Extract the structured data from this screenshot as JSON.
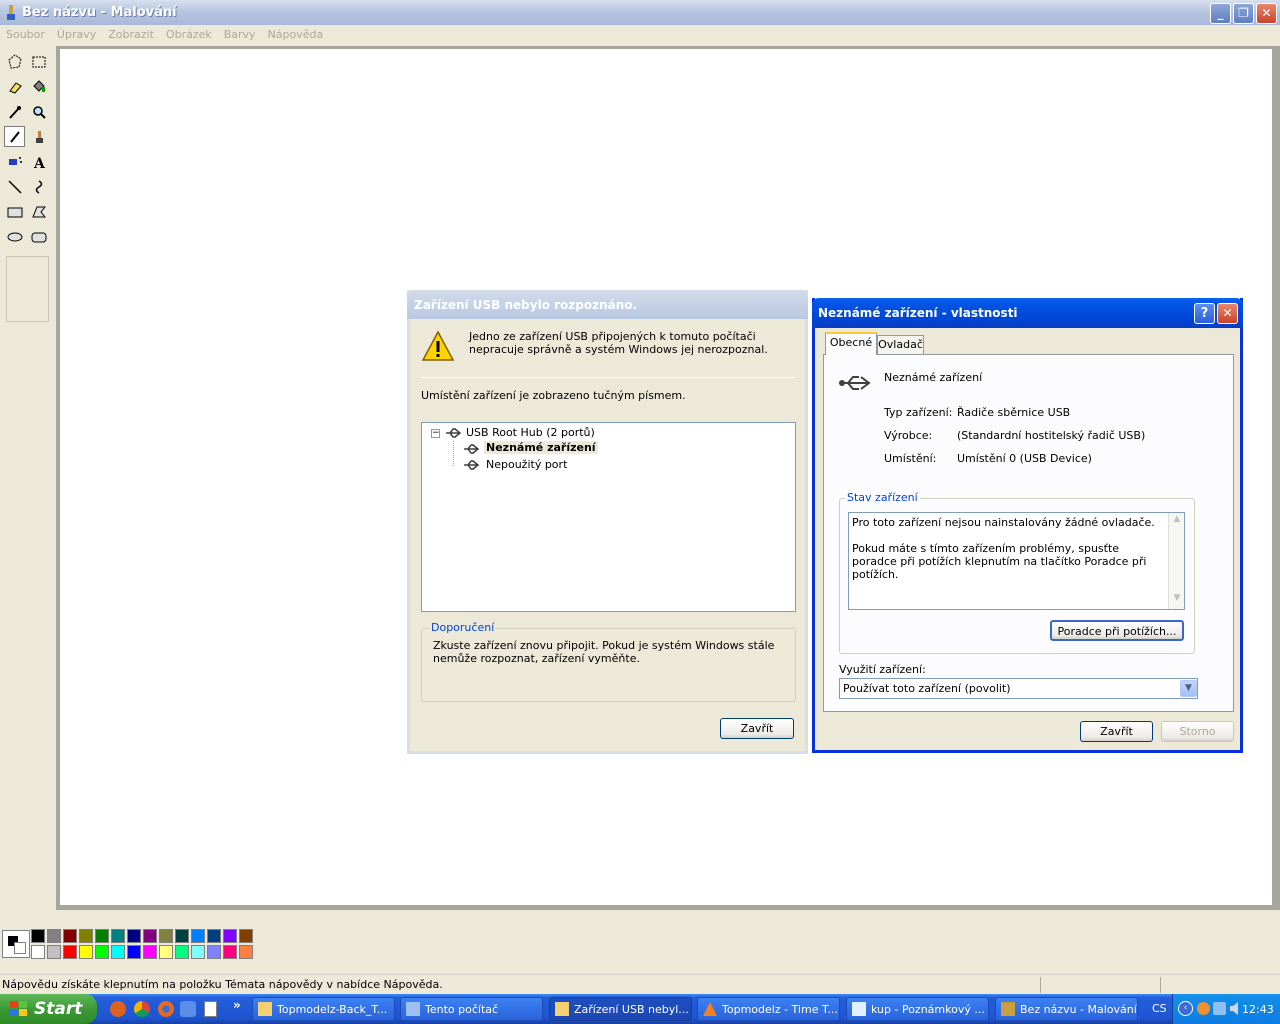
{
  "paint": {
    "title": "Bez názvu - Malování",
    "menu": [
      "Soubor",
      "Úpravy",
      "Zobrazit",
      "Obrázek",
      "Barvy",
      "Nápověda"
    ],
    "status": "Nápovědu získáte klepnutím na položku Témata nápovědy v nabídce Nápověda.",
    "palette_top": [
      "#000000",
      "#808080",
      "#800000",
      "#808000",
      "#008000",
      "#008080",
      "#000080",
      "#800080",
      "#808040",
      "#004040",
      "#0080ff",
      "#004080",
      "#8000ff",
      "#804000"
    ],
    "palette_bottom": [
      "#ffffff",
      "#c0c0c0",
      "#ff0000",
      "#ffff00",
      "#00ff00",
      "#00ffff",
      "#0000ff",
      "#ff00ff",
      "#ffff80",
      "#00ff80",
      "#80ffff",
      "#8080ff",
      "#ff0080",
      "#ff8040"
    ]
  },
  "usb_dialog": {
    "title": "Zařízení USB nebylo rozpoznáno.",
    "message": "Jedno ze zařízení USB připojených k tomuto počítači nepracuje správně a systém Windows jej nerozpoznal.",
    "location_note": "Umístění zařízení je zobrazeno tučným písmem.",
    "tree": {
      "root": "USB Root Hub (2 portů)",
      "child_bold": "Neznámé zařízení",
      "child_unused": "Nepoužitý port"
    },
    "recommend_label": "Doporučení",
    "recommend_text": "Zkuste zařízení znovu připojit. Pokud je systém Windows stále nemůže rozpoznat, zařízení vyměňte.",
    "close_button": "Zavřít"
  },
  "props_dialog": {
    "title": "Neznámé zařízení - vlastnosti",
    "help_button": "?",
    "tabs": [
      "Obecné",
      "Ovladač"
    ],
    "device_name": "Neznámé zařízení",
    "fields": [
      {
        "label": "Typ zařízení:",
        "value": "Řadiče sběrnice USB"
      },
      {
        "label": "Výrobce:",
        "value": "(Standardní hostitelský řadič USB)"
      },
      {
        "label": "Umístění:",
        "value": "Umístění 0 (USB Device)"
      }
    ],
    "status_group": "Stav zařízení",
    "status_line1": "Pro toto zařízení nejsou nainstalovány žádné ovladače.",
    "status_line2": "Pokud máte s tímto zařízením problémy, spusťte poradce při potížích klepnutím na tlačítko Poradce při potížích.",
    "troubleshoot_button": "Poradce při potížích...",
    "usage_label": "Využití zařízení:",
    "usage_value": "Používat toto zařízení (povolit)",
    "ok_button": "Zavřít",
    "cancel_button": "Storno"
  },
  "taskbar": {
    "start": "Start",
    "tasks": [
      "Topmodelz-Back_T...",
      "Tento počítač",
      "Zařízení USB nebyl...",
      "Topmodelz - Time T...",
      "kup - Poznámkový ...",
      "Bez názvu - Malování"
    ],
    "lang": "CS",
    "time": "12:43",
    "quicklaunch_more": "»"
  }
}
